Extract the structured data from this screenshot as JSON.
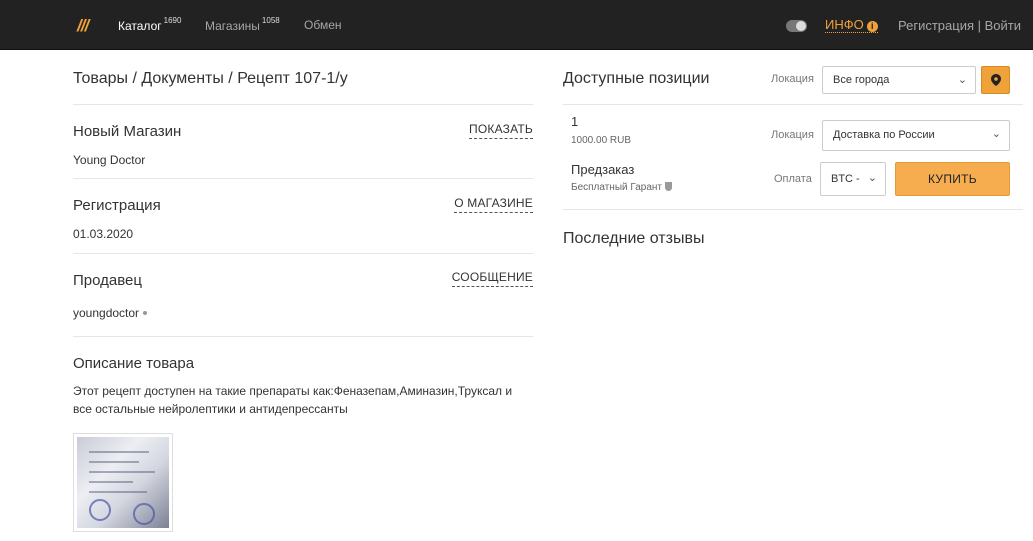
{
  "header": {
    "logo": "///",
    "nav": [
      {
        "label": "Каталог",
        "count": "1690"
      },
      {
        "label": "Магазины",
        "count": "1058"
      },
      {
        "label": "Обмен",
        "count": ""
      }
    ],
    "info_label": "ИНФО",
    "info_icon": "i",
    "auth_label": "Регистрация | Войти"
  },
  "left": {
    "breadcrumb": "Товары / Документы / Рецепт 107-1/у",
    "shop": {
      "title": "Новый Магазин",
      "value": "Young Doctor",
      "link": "ПОКАЗАТЬ"
    },
    "registration": {
      "title": "Регистрация",
      "value": "01.03.2020",
      "link": "О МАГАЗИНЕ"
    },
    "seller": {
      "title": "Продавец",
      "value": "youngdoctor",
      "link": "СООБЩЕНИЕ"
    },
    "description": {
      "title": "Описание товара",
      "text": "Этот рецепт доступен на такие препараты как:Феназепам,Аминазин,Труксал и все остальные нейролептики и антидепрессанты"
    }
  },
  "right": {
    "title": "Доступные позиции",
    "location_label": "Локация",
    "location_value": "Все города",
    "position": {
      "number": "1",
      "price": "1000.00 RUB",
      "location_label": "Локация",
      "delivery_value": "Доставка по России",
      "mode": "Предзаказ",
      "guarantee": "Бесплатный Гарант",
      "payment_label": "Оплата",
      "payment_value": "BTC -",
      "buy_label": "КУПИТЬ"
    },
    "reviews_title": "Последние отзывы"
  },
  "colors": {
    "accent": "#f0a23a",
    "topbar": "#222222"
  }
}
